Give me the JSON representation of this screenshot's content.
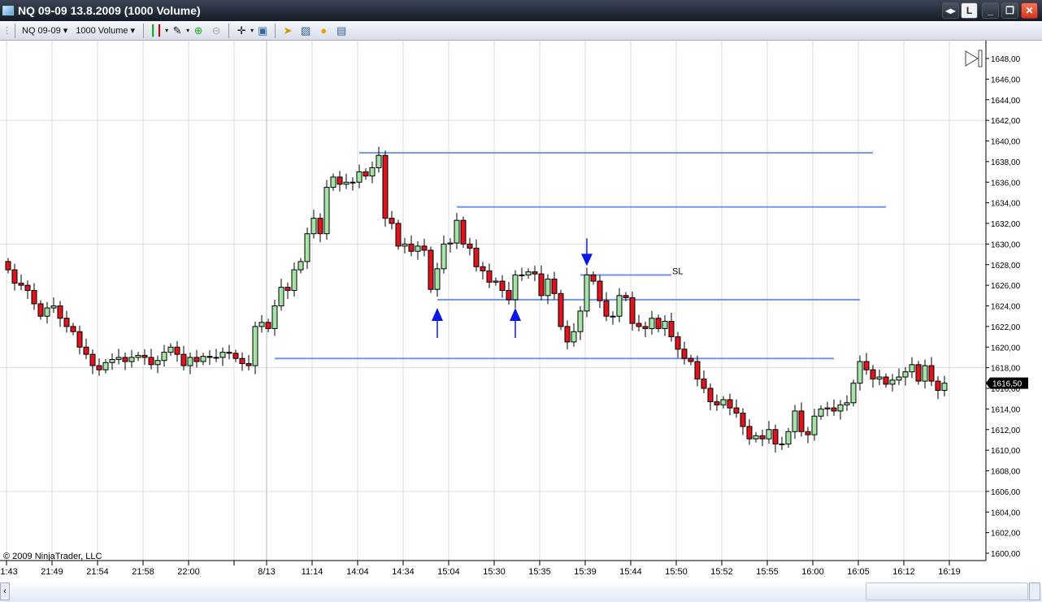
{
  "window": {
    "title": "NQ 09-09  13.8.2009 (1000 Volume)",
    "buttons": {
      "link": "◂▸",
      "layout": "L",
      "minimize": "_",
      "restore": "❐",
      "close": "✕"
    }
  },
  "toolbar": {
    "instrument": "NQ 09-09",
    "interval": "1000 Volume"
  },
  "chart": {
    "copyright": "© 2009 NinjaTrader, LLC",
    "last_price_label": "1616,50",
    "y_range": [
      1600,
      1648
    ],
    "y_ticks": [
      1600,
      1602,
      1604,
      1606,
      1608,
      1610,
      1612,
      1614,
      1616,
      1618,
      1620,
      1622,
      1624,
      1626,
      1628,
      1630,
      1632,
      1634,
      1636,
      1638,
      1640,
      1642,
      1644,
      1646,
      1648
    ],
    "y_grid": [
      1606,
      1618,
      1630,
      1642
    ],
    "x_labels": [
      {
        "bar": 0,
        "t": "21:43"
      },
      {
        "bar": 7,
        "t": "21:49"
      },
      {
        "bar": 14,
        "t": "21:54"
      },
      {
        "bar": 21,
        "t": "21:58"
      },
      {
        "bar": 28,
        "t": "22:00"
      },
      {
        "bar": 35,
        "t": ""
      },
      {
        "bar": 40,
        "t": "8/13"
      },
      {
        "bar": 47,
        "t": "11:14"
      },
      {
        "bar": 54,
        "t": "14:04"
      },
      {
        "bar": 61,
        "t": "14:34"
      },
      {
        "bar": 68,
        "t": "15:04"
      },
      {
        "bar": 75,
        "t": "15:30"
      },
      {
        "bar": 82,
        "t": "15:35"
      },
      {
        "bar": 89,
        "t": "15:39"
      },
      {
        "bar": 96,
        "t": "15:44"
      },
      {
        "bar": 103,
        "t": "15:50"
      },
      {
        "bar": 110,
        "t": "15:52"
      },
      {
        "bar": 117,
        "t": "15:55"
      },
      {
        "bar": 124,
        "t": "16:00"
      },
      {
        "bar": 131,
        "t": "16:05"
      },
      {
        "bar": 138,
        "t": "16:12"
      },
      {
        "bar": 145,
        "t": "16:19"
      }
    ],
    "day_break_bar": 40,
    "first_open": 1628.3,
    "closes": [
      1627.5,
      1626.2,
      1626.0,
      1625.5,
      1624.2,
      1623.0,
      1623.8,
      1624.0,
      1622.8,
      1622.0,
      1621.5,
      1620.0,
      1619.3,
      1618.2,
      1617.8,
      1618.5,
      1618.8,
      1619.0,
      1618.6,
      1619.0,
      1619.2,
      1619.0,
      1618.3,
      1618.7,
      1619.5,
      1620.0,
      1619.3,
      1618.2,
      1619.0,
      1618.6,
      1619.1,
      1619.0,
      1619.0,
      1619.5,
      1619.4,
      1618.9,
      1618.4,
      1618.2,
      1622.0,
      1622.4,
      1621.8,
      1624.0,
      1625.8,
      1625.5,
      1627.5,
      1628.3,
      1631.0,
      1632.5,
      1631.0,
      1635.5,
      1636.5,
      1635.8,
      1636.0,
      1636.0,
      1637.0,
      1636.6,
      1637.4,
      1638.6,
      1632.5,
      1632.0,
      1629.8,
      1630.0,
      1629.3,
      1629.8,
      1629.4,
      1625.6,
      1627.6,
      1630.0,
      1630.1,
      1632.3,
      1630.0,
      1629.6,
      1627.8,
      1627.4,
      1626.3,
      1626.4,
      1625.5,
      1624.6,
      1627.0,
      1627.0,
      1627.3,
      1627.1,
      1625.0,
      1626.6,
      1625.2,
      1622.0,
      1620.5,
      1621.5,
      1623.5,
      1627.0,
      1626.4,
      1624.5,
      1623.0,
      1623.0,
      1625.0,
      1624.8,
      1622.3,
      1622.0,
      1621.8,
      1622.8,
      1621.8,
      1622.5,
      1621.0,
      1619.8,
      1618.9,
      1618.6,
      1616.9,
      1616.0,
      1614.7,
      1614.4,
      1614.9,
      1614.1,
      1613.6,
      1612.3,
      1611.1,
      1611.4,
      1611.1,
      1612.0,
      1610.6,
      1610.6,
      1611.8,
      1613.8,
      1611.8,
      1611.5,
      1613.3,
      1614.0,
      1614.1,
      1613.8,
      1614.4,
      1614.6,
      1616.5,
      1618.6,
      1617.8,
      1616.9,
      1617.1,
      1616.4,
      1616.8,
      1617.1,
      1617.6,
      1618.3,
      1616.7,
      1618.2,
      1616.7,
      1615.8,
      1616.5
    ],
    "lines": [
      {
        "price": 1638.85,
        "from": 54,
        "to": 133,
        "label": ""
      },
      {
        "price": 1633.6,
        "from": 69,
        "to": 135,
        "label": ""
      },
      {
        "price": 1627.0,
        "from": 88,
        "to": 102,
        "label": "SL"
      },
      {
        "price": 1624.6,
        "from": 66,
        "to": 131,
        "label": ""
      },
      {
        "price": 1618.9,
        "from": 41,
        "to": 127,
        "label": ""
      }
    ],
    "arrows": [
      {
        "bar": 66,
        "dir": "up",
        "price": 1624.2
      },
      {
        "bar": 78,
        "dir": "up",
        "price": 1624.2
      },
      {
        "bar": 89,
        "dir": "down",
        "price": 1627.4
      }
    ],
    "colors": {
      "up": "#a6e3a6",
      "down": "#e0141c",
      "line": "#6f96e8",
      "arrow": "#0a18e6",
      "grid": "#dcdcdc"
    }
  }
}
